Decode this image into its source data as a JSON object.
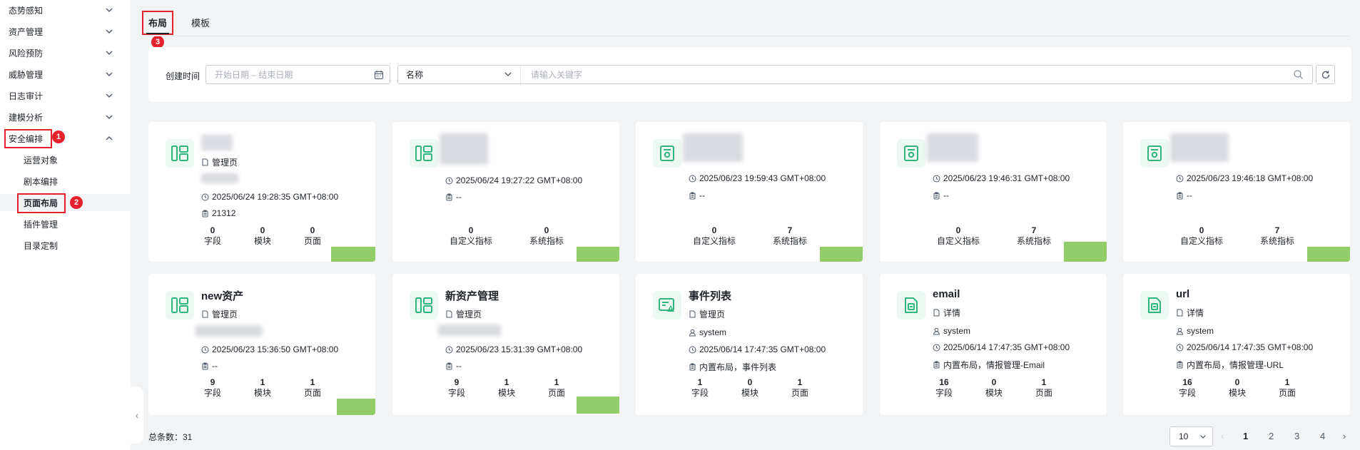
{
  "sidebar": {
    "items": [
      {
        "label": "态势感知"
      },
      {
        "label": "资产管理"
      },
      {
        "label": "风险预防"
      },
      {
        "label": "威胁管理"
      },
      {
        "label": "日志审计"
      },
      {
        "label": "建模分析"
      },
      {
        "label": "安全编排"
      }
    ],
    "subitems": [
      {
        "label": "运营对象"
      },
      {
        "label": "剧本编排"
      },
      {
        "label": "页面布局"
      },
      {
        "label": "插件管理"
      },
      {
        "label": "目录定制"
      }
    ],
    "collapse_icon": "chevron-left-icon"
  },
  "annotations": {
    "badge1": "1",
    "badge2": "2",
    "badge3": "3"
  },
  "tabs": [
    {
      "label": "布局"
    },
    {
      "label": "模板"
    }
  ],
  "filter": {
    "created_label": "创建时间",
    "date_placeholder": "开始日期 – 结束日期",
    "field_select": "名称",
    "search_placeholder": "请输入关键字"
  },
  "cards": [
    {
      "type": "管理页",
      "timestamp": "2025/06/24 19:28:35 GMT+08:00",
      "desc": "21312",
      "stats": [
        {
          "value": "0",
          "label": "字段"
        },
        {
          "value": "0",
          "label": "模块"
        },
        {
          "value": "0",
          "label": "页面"
        }
      ]
    },
    {
      "timestamp": "2025/06/24 19:27:22 GMT+08:00",
      "desc": "--",
      "stats": [
        {
          "value": "0",
          "label": "自定义指标"
        },
        {
          "value": "0",
          "label": "系统指标"
        }
      ]
    },
    {
      "timestamp": "2025/06/23 19:59:43 GMT+08:00",
      "desc": "--",
      "stats": [
        {
          "value": "0",
          "label": "自定义指标"
        },
        {
          "value": "7",
          "label": "系统指标"
        }
      ]
    },
    {
      "timestamp": "2025/06/23 19:46:31 GMT+08:00",
      "desc": "--",
      "stats": [
        {
          "value": "0",
          "label": "自定义指标"
        },
        {
          "value": "7",
          "label": "系统指标"
        }
      ]
    },
    {
      "timestamp": "2025/06/23 19:46:18 GMT+08:00",
      "desc": "--",
      "stats": [
        {
          "value": "0",
          "label": "自定义指标"
        },
        {
          "value": "7",
          "label": "系统指标"
        }
      ]
    },
    {
      "title": "new资产",
      "type": "管理页",
      "timestamp": "2025/06/23 15:36:50 GMT+08:00",
      "desc": "--",
      "stats": [
        {
          "value": "9",
          "label": "字段"
        },
        {
          "value": "1",
          "label": "模块"
        },
        {
          "value": "1",
          "label": "页面"
        }
      ]
    },
    {
      "title": "新资产管理",
      "type": "管理页",
      "timestamp": "2025/06/23 15:31:39 GMT+08:00",
      "desc": "--",
      "stats": [
        {
          "value": "9",
          "label": "字段"
        },
        {
          "value": "1",
          "label": "模块"
        },
        {
          "value": "1",
          "label": "页面"
        }
      ]
    },
    {
      "title": "事件列表",
      "type": "管理页",
      "user": "system",
      "timestamp": "2025/06/14 17:47:35 GMT+08:00",
      "desc": "内置布局，事件列表",
      "stats": [
        {
          "value": "1",
          "label": "字段"
        },
        {
          "value": "0",
          "label": "模块"
        },
        {
          "value": "1",
          "label": "页面"
        }
      ]
    },
    {
      "title": "email",
      "type": "详情",
      "user": "system",
      "timestamp": "2025/06/14 17:47:35 GMT+08:00",
      "desc": "内置布局，情报管理-Email",
      "stats": [
        {
          "value": "16",
          "label": "字段"
        },
        {
          "value": "0",
          "label": "模块"
        },
        {
          "value": "1",
          "label": "页面"
        }
      ]
    },
    {
      "title": "url",
      "type": "详情",
      "user": "system",
      "timestamp": "2025/06/14 17:47:35 GMT+08:00",
      "desc": "内置布局，情报管理-URL",
      "stats": [
        {
          "value": "16",
          "label": "字段"
        },
        {
          "value": "0",
          "label": "模块"
        },
        {
          "value": "1",
          "label": "页面"
        }
      ]
    }
  ],
  "footer": {
    "total": "总条数：31",
    "page_size": "10",
    "pages": [
      "1",
      "2",
      "3",
      "4"
    ]
  },
  "colors": {
    "accent": "#e5212d",
    "icon_green": "#2fb67c",
    "icon_bg": "#eef8f3"
  }
}
